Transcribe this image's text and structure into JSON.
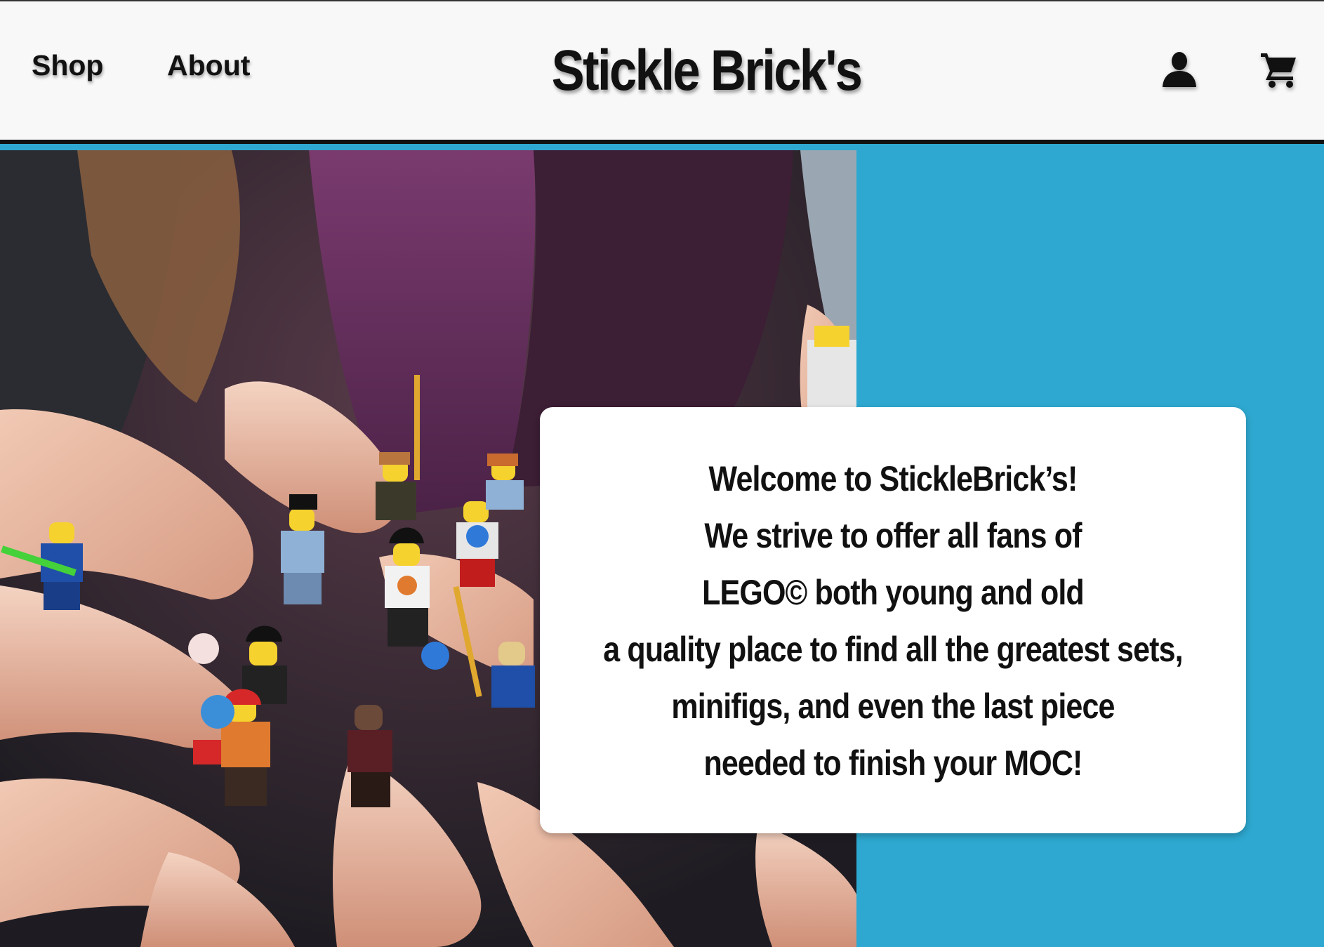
{
  "header": {
    "brand": "Stickle Brick's",
    "nav": [
      {
        "label": "Shop"
      },
      {
        "label": "About"
      }
    ],
    "icons": [
      "user-icon",
      "cart-icon"
    ]
  },
  "hero": {
    "image_alt": "Hands holding LEGO minifigures",
    "welcome": {
      "lines": [
        "Welcome to StickleBrick’s!",
        "We strive to offer all fans of",
        "LEGO© both young and old",
        "a quality place to find all the greatest sets,",
        "minifigs, and even the last piece",
        "needed to finish your MOC!"
      ]
    }
  },
  "colors": {
    "accent": "#2ea8d0",
    "header_bg": "#f8f8f8",
    "text": "#111111",
    "card_bg": "#ffffff"
  }
}
